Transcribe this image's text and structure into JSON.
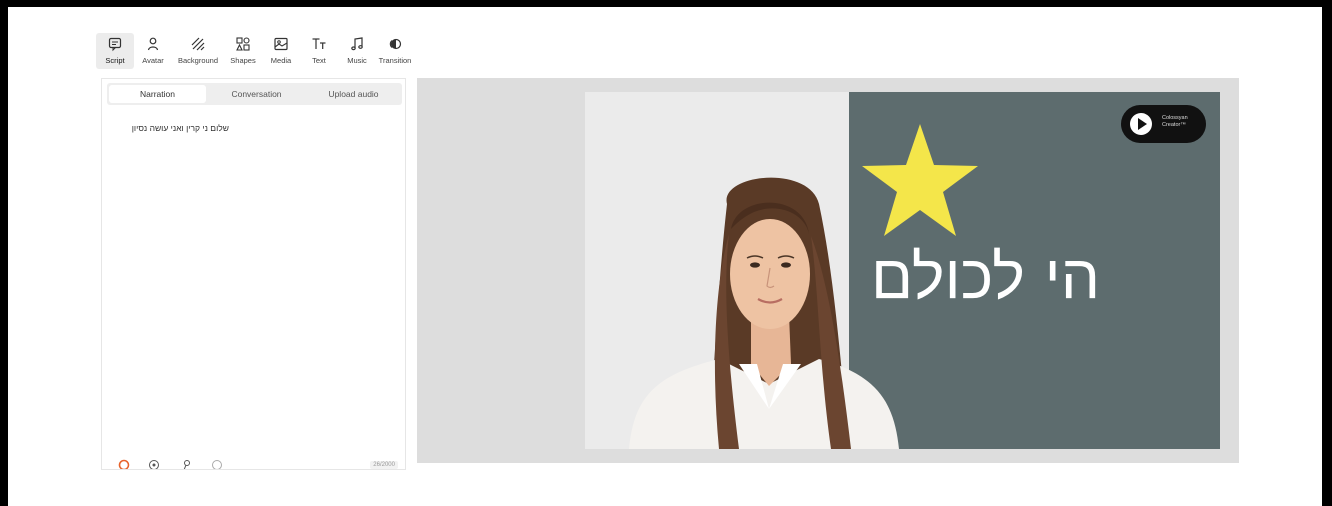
{
  "toolbar": {
    "items": [
      {
        "label": "Script",
        "icon": "script-icon"
      },
      {
        "label": "Avatar",
        "icon": "avatar-icon"
      },
      {
        "label": "Background",
        "icon": "background-icon"
      },
      {
        "label": "Shapes",
        "icon": "shapes-icon"
      },
      {
        "label": "Media",
        "icon": "media-icon"
      },
      {
        "label": "Text",
        "icon": "text-icon"
      },
      {
        "label": "Music",
        "icon": "music-icon"
      },
      {
        "label": "Transition",
        "icon": "transition-icon"
      }
    ]
  },
  "script_panel": {
    "tabs": [
      {
        "label": "Narration",
        "active": true
      },
      {
        "label": "Conversation",
        "active": false
      },
      {
        "label": "Upload audio",
        "active": false
      }
    ],
    "text": "שלום ני קרין ואני עושה נסיון",
    "counter": "26/2000"
  },
  "slide": {
    "headline": "הי לכולם",
    "logo_line1": "Colossyan",
    "logo_line2": "Creator™",
    "background_color": "#5d6c6e",
    "star_color": "#f4e64a"
  },
  "colors": {
    "accent": "#e8632b"
  }
}
